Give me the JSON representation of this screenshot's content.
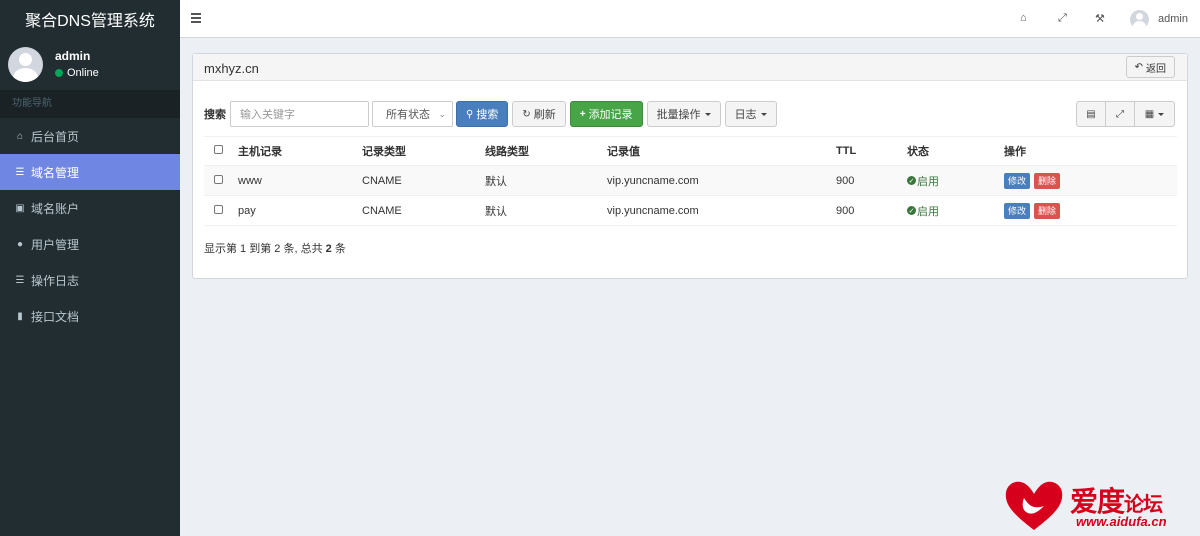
{
  "app": {
    "title": "聚合DNS管理系统"
  },
  "user": {
    "name": "admin",
    "status": "Online"
  },
  "nav": {
    "header": "功能导航",
    "items": [
      {
        "icon": "home-icon",
        "label": "后台首页"
      },
      {
        "icon": "list-icon",
        "label": "域名管理",
        "active": true
      },
      {
        "icon": "lock-icon",
        "label": "域名账户"
      },
      {
        "icon": "user-icon",
        "label": "用户管理"
      },
      {
        "icon": "list-icon",
        "label": "操作日志"
      },
      {
        "icon": "book-icon",
        "label": "接口文档"
      }
    ]
  },
  "topbar": {
    "username": "admin"
  },
  "domain": {
    "title": "mxhyz.cn",
    "back_label": "返回"
  },
  "toolbar": {
    "search_label": "搜索",
    "search_placeholder": "输入关键字",
    "status_select": "所有状态",
    "search_button": "搜索",
    "refresh_button": "刷新",
    "add_button": "添加记录",
    "batch_button": "批量操作",
    "log_button": "日志"
  },
  "table": {
    "headers": [
      "主机记录",
      "记录类型",
      "线路类型",
      "记录值",
      "TTL",
      "状态",
      "操作"
    ],
    "rows": [
      {
        "host": "www",
        "type": "CNAME",
        "line": "默认",
        "value": "vip.yuncname.com",
        "ttl": "900",
        "status": "启用",
        "edit": "修改",
        "delete": "删除"
      },
      {
        "host": "pay",
        "type": "CNAME",
        "line": "默认",
        "value": "vip.yuncname.com",
        "ttl": "900",
        "status": "启用",
        "edit": "修改",
        "delete": "删除"
      }
    ]
  },
  "summary": {
    "prefix": "显示第 1 到第 2 条, 总共 ",
    "total": "2",
    "suffix": " 条"
  },
  "watermark": {
    "title_main": "爱度",
    "title_small": "论坛",
    "url": "www.aidufa.cn"
  },
  "colors": {
    "sidebar_bg": "#222d32",
    "nav_active": "#6f87e3",
    "primary": "#4a7fbd",
    "success": "#47a447",
    "danger": "#d9534f",
    "status_ok": "#3c763d"
  }
}
